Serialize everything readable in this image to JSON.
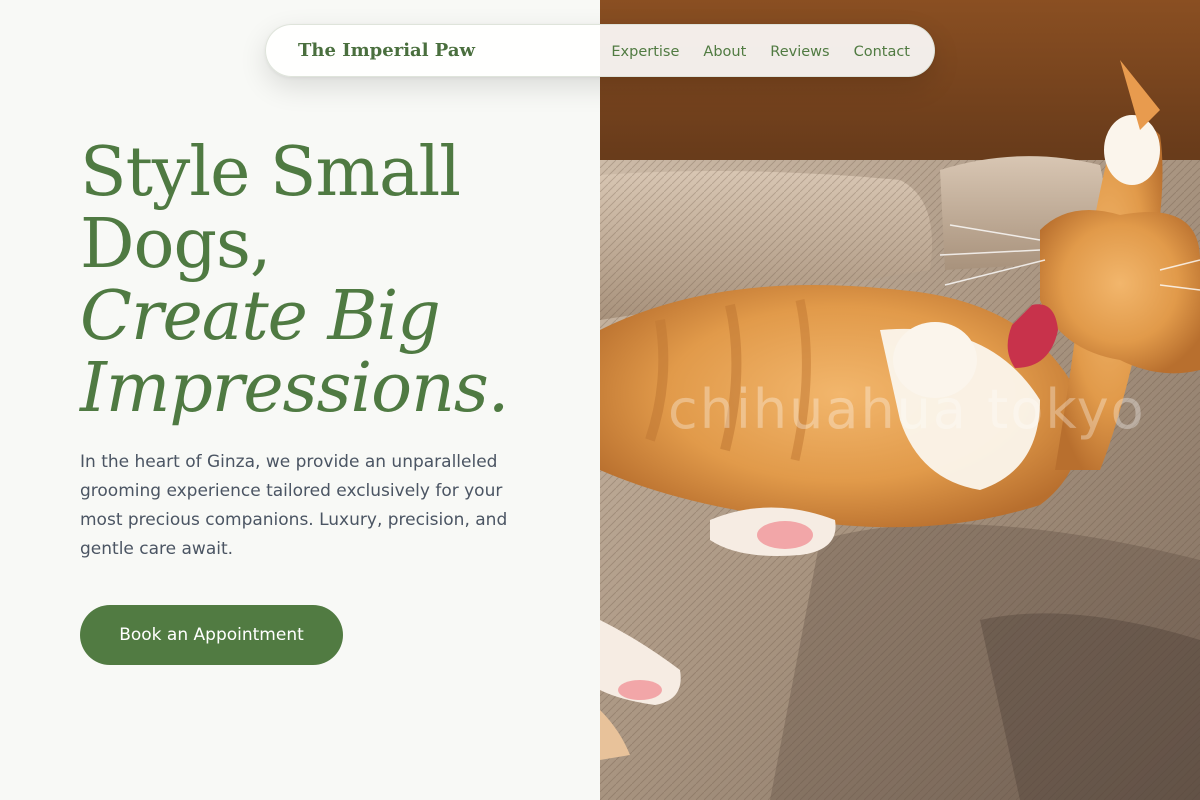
{
  "nav": {
    "brand": "The Imperial Paw",
    "links": [
      "Expertise",
      "About",
      "Reviews",
      "Contact"
    ]
  },
  "hero": {
    "headline_line1": "Style Small",
    "headline_line2": "Dogs,",
    "headline_line3": "Create Big",
    "headline_line4": "Impressions.",
    "body": "In the heart of Ginza, we provide an unparalleled grooming experience tailored exclusively for your most precious companions. Luxury, precision, and gentle care await.",
    "cta_label": "Book an Appointment"
  },
  "photo": {
    "watermark": "chihuahua tokyo"
  },
  "colors": {
    "accent": "#517b42",
    "heading": "#4f7a42",
    "body_text": "#4b5563",
    "background": "#f8f9f6"
  }
}
